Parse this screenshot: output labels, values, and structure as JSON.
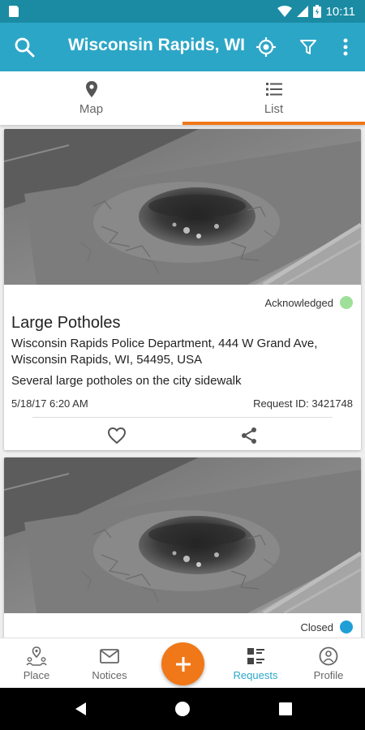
{
  "status_bar": {
    "time": "10:11",
    "icons": [
      "sim-icon",
      "wifi-icon",
      "signal-icon",
      "battery-icon"
    ]
  },
  "app_bar": {
    "title": "Wisconsin Rapids, WI",
    "icons": [
      "search-icon",
      "locate-icon",
      "filter-icon",
      "more-vert-icon"
    ],
    "color": "#2ca6c7"
  },
  "tabs": [
    {
      "label": "Map",
      "icon": "map-pin-icon",
      "selected": false
    },
    {
      "label": "List",
      "icon": "list-icon",
      "selected": true
    }
  ],
  "accent_color": "#f07818",
  "requests": [
    {
      "image": "pothole-photo",
      "status": "Acknowledged",
      "status_color": "#9ee09a",
      "title": "Large Potholes",
      "address": "Wisconsin Rapids Police Department, 444 W Grand Ave, Wisconsin Rapids, WI, 54495, USA",
      "description": "Several large potholes on the city sidewalk",
      "date": "5/18/17 6:20 AM",
      "request_id": "Request ID: 3421748"
    },
    {
      "image": "pothole-photo",
      "status": "Closed",
      "status_color": "#1f9fd6"
    }
  ],
  "bottom_nav": [
    {
      "label": "Place",
      "icon": "place-icon"
    },
    {
      "label": "Notices",
      "icon": "mail-icon"
    },
    {
      "label": "Requests",
      "icon": "requests-icon",
      "active": true
    },
    {
      "label": "Profile",
      "icon": "profile-icon"
    }
  ],
  "fab": {
    "icon": "plus-icon",
    "color": "#f07818"
  },
  "system_nav": [
    "back-icon",
    "home-icon",
    "recents-icon"
  ]
}
